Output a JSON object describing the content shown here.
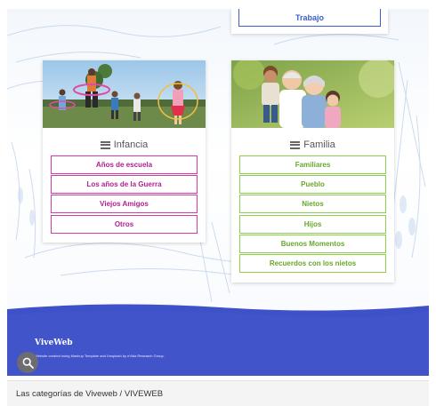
{
  "top_card": {
    "button_label": "Trabajo"
  },
  "categories": [
    {
      "title": "Infancia",
      "items": [
        "Años de escuela",
        "Los años de la Guerra",
        "Viejos Amigos",
        "Otros"
      ]
    },
    {
      "title": "Familia",
      "items": [
        "Familiares",
        "Pueblo",
        "Nietos",
        "Hijos",
        "Buenos Momentos",
        "Recuerdos con los nietos"
      ]
    }
  ],
  "footer": {
    "title": "ViveWeb",
    "credit": "Website created using Mashup Template and Unsplash by eVida Research Group.",
    "search_icon": "search-icon"
  },
  "statusbar": {
    "text": "Las categorías de Viveweb / VIVEWEB"
  },
  "colors": {
    "footer_blue": "#3f51c9",
    "pink_accent": "#d43aa8",
    "green_accent": "#8ccf4d",
    "trabajo_blue": "#3a5fc9"
  }
}
